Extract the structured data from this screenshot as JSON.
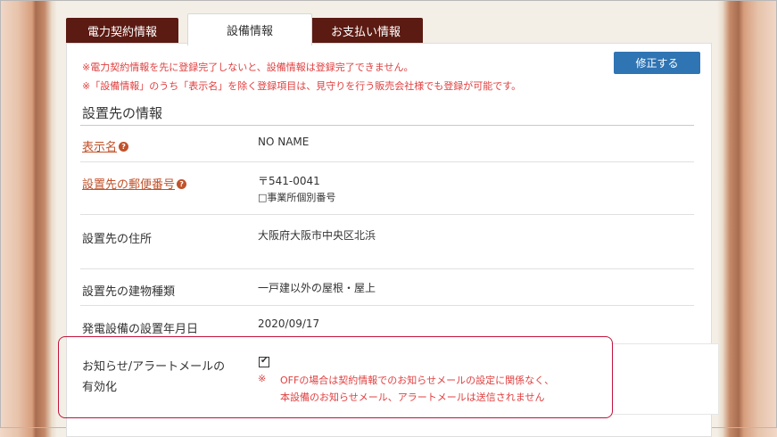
{
  "tabs": {
    "contract": "電力契約情報",
    "equipment": "設備情報",
    "payment": "お支払い情報"
  },
  "notices": {
    "line1": "※電力契約情報を先に登録完了しないと、設備情報は登録完了できません。",
    "line2": "※「設備情報」のうち「表示名」を除く登録項目は、見守りを行う販売会社様でも登録が可能です。"
  },
  "edit_button": "修正する",
  "section_title": "設置先の情報",
  "help_icon": "?",
  "fields": {
    "display_name": {
      "label": "表示名",
      "value": "NO NAME"
    },
    "postal_code": {
      "label": "設置先の郵便番号",
      "value": "〒541-0041",
      "sub": "□事業所個別番号"
    },
    "address": {
      "label": "設置先の住所",
      "value": "大阪府大阪市中央区北浜"
    },
    "building_type": {
      "label": "設置先の建物種類",
      "value": "一戸建以外の屋根・屋上"
    },
    "install_date": {
      "label": "発電設備の設置年月日",
      "value": "2020/09/17"
    },
    "alert_mail": {
      "label_line1": "お知らせ/アラートメールの",
      "label_line2": "有効化",
      "checked": true,
      "check_glyph": "✔",
      "note_mark": "※",
      "note_line1": "OFFの場合は契約情報でのお知らせメールの設定に関係なく、",
      "note_line2": "本設備のお知らせメール、アラートメールは送信されません"
    }
  },
  "colors": {
    "tab_bg": "#5b1a12",
    "link": "#c1522a",
    "notice": "#e04040",
    "button": "#2f74b3",
    "highlight": "#c0143c"
  }
}
